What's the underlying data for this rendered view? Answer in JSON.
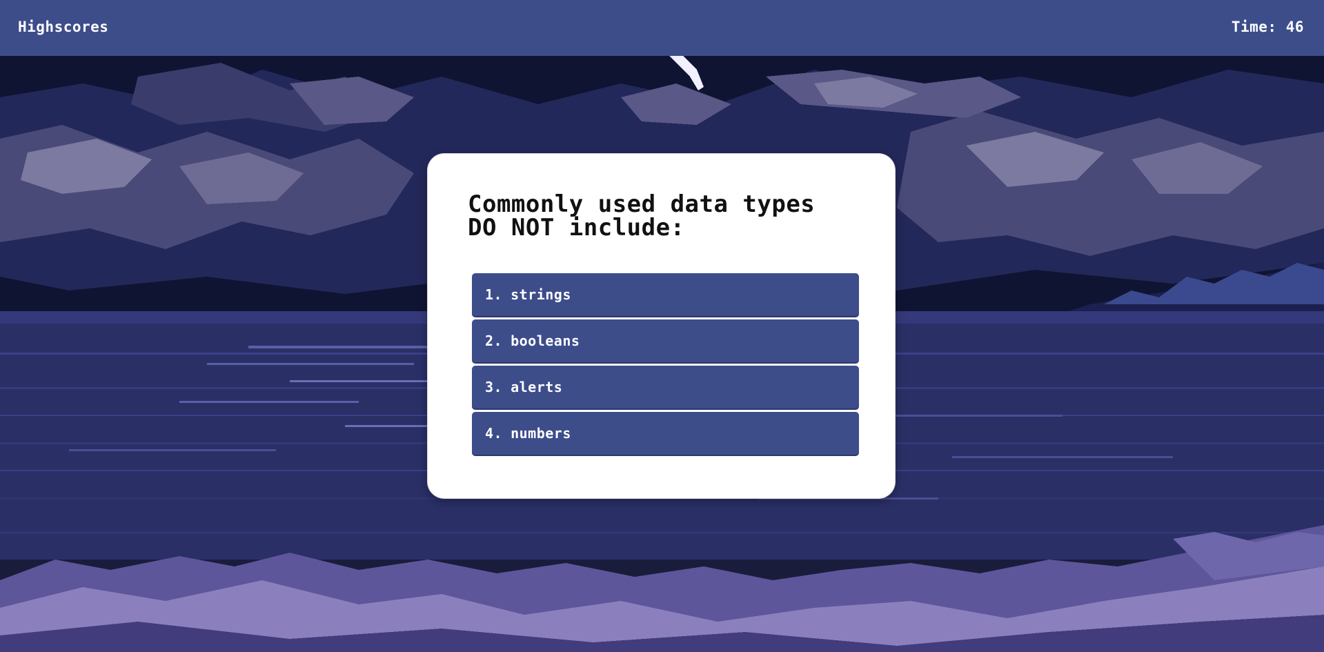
{
  "header": {
    "highscores_label": "Highscores",
    "timer_label": "Time:",
    "timer_value": "46"
  },
  "quiz": {
    "question": "Commonly used data types DO NOT include:",
    "answers": [
      {
        "number": "1.",
        "text": "strings"
      },
      {
        "number": "2.",
        "text": "booleans"
      },
      {
        "number": "3.",
        "text": "alerts"
      },
      {
        "number": "4.",
        "text": "numbers"
      }
    ]
  },
  "colors": {
    "header_bg": "#3d4d8a",
    "button_bg": "#3d4d8a",
    "card_bg": "#ffffff",
    "sky_dark": "#0e1230",
    "cloud_mid": "#4a4a78",
    "cloud_light": "#7c7aa0",
    "sea": "#2a2f66",
    "dune": "#8b7fbe"
  },
  "icons": {
    "background": "pixel-night-ocean-background"
  }
}
